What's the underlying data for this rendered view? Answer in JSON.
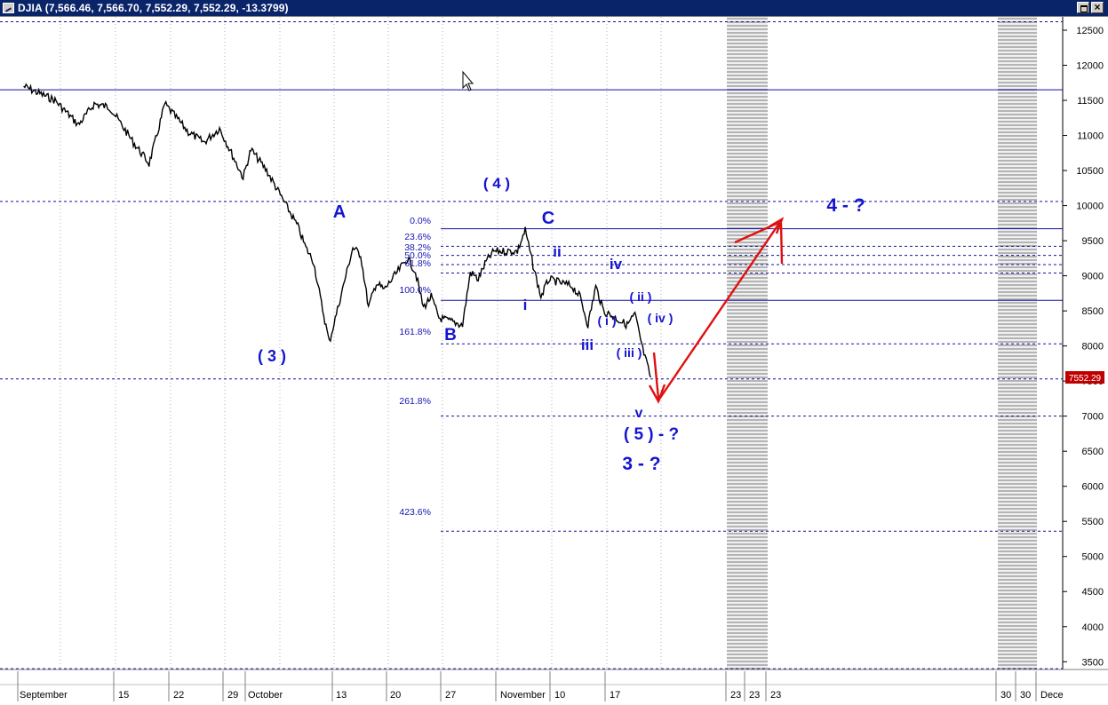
{
  "window": {
    "title": "DJIA (7,566.46, 7,566.70, 7,552.29, 7,552.29, -13.3799)"
  },
  "colors": {
    "titlebar": "#0a246a",
    "price": "#000000",
    "level_line": "#1010a0",
    "wave_label": "#1414d2",
    "projection_arrow": "#e01010",
    "last_price_badge": "#c00000"
  },
  "icons": [
    "app-icon",
    "restore-icon",
    "close-icon",
    "cursor-arrow-icon"
  ],
  "chart_data": {
    "type": "line",
    "title": "DJIA",
    "ylim": [
      3100,
      12650
    ],
    "y_ticks": [
      3500,
      4000,
      4500,
      5000,
      5500,
      6000,
      6500,
      7000,
      7500,
      8000,
      8500,
      9000,
      9500,
      10000,
      10500,
      11000,
      11500,
      12000,
      12500
    ],
    "x_labels": [
      "September",
      "15",
      "22",
      "29",
      "October",
      "13",
      "20",
      "27",
      "November",
      "10",
      "17",
      "23",
      "23",
      "23",
      "30",
      "30",
      "Dece"
    ],
    "grid": "vertical dotted",
    "last_price": "7552.29",
    "series": [
      {
        "values_approx": [
          [
            "2008-09-01",
            11700
          ],
          [
            "2008-09-05",
            11500
          ],
          [
            "2008-09-08",
            11150
          ],
          [
            "2008-09-10",
            11450
          ],
          [
            "2008-09-12",
            11400
          ],
          [
            "2008-09-15",
            10900
          ],
          [
            "2008-09-17",
            10600
          ],
          [
            "2008-09-18",
            11000
          ],
          [
            "2008-09-19",
            11450
          ],
          [
            "2008-09-22",
            11050
          ],
          [
            "2008-09-24",
            10900
          ],
          [
            "2008-09-26",
            11100
          ],
          [
            "2008-09-29",
            10400
          ],
          [
            "2008-09-30",
            10800
          ],
          [
            "2008-10-02",
            10500
          ],
          [
            "2008-10-03",
            10300
          ],
          [
            "2008-10-06",
            9700
          ],
          [
            "2008-10-07",
            9400
          ],
          [
            "2008-10-08",
            9200
          ],
          [
            "2008-10-09",
            8600
          ],
          [
            "2008-10-10",
            8050
          ],
          [
            "2008-10-13",
            9400
          ],
          [
            "2008-10-14",
            9300
          ],
          [
            "2008-10-15",
            8550
          ],
          [
            "2008-10-16",
            8900
          ],
          [
            "2008-10-17",
            8800
          ],
          [
            "2008-10-20",
            9250
          ],
          [
            "2008-10-21",
            9050
          ],
          [
            "2008-10-22",
            8550
          ],
          [
            "2008-10-23",
            8700
          ],
          [
            "2008-10-24",
            8400
          ],
          [
            "2008-10-27",
            8300
          ],
          [
            "2008-10-28",
            9050
          ],
          [
            "2008-10-29",
            8950
          ],
          [
            "2008-10-30",
            9200
          ],
          [
            "2008-10-31",
            9350
          ],
          [
            "2008-11-03",
            9350
          ],
          [
            "2008-11-04",
            9650
          ],
          [
            "2008-11-05",
            9150
          ],
          [
            "2008-11-06",
            8700
          ],
          [
            "2008-11-07",
            8950
          ],
          [
            "2008-11-10",
            8850
          ],
          [
            "2008-11-11",
            8700
          ],
          [
            "2008-11-12",
            8300
          ],
          [
            "2008-11-13",
            8850
          ],
          [
            "2008-11-14",
            8500
          ],
          [
            "2008-11-17",
            8300
          ],
          [
            "2008-11-18",
            8450
          ],
          [
            "2008-11-19",
            7950
          ],
          [
            "2008-11-20",
            7552
          ]
        ]
      }
    ],
    "horizontal_levels": [
      {
        "value": 12620,
        "style": "dashed"
      },
      {
        "value": 11650,
        "style": "solid"
      },
      {
        "value": 10060,
        "style": "dashed"
      },
      {
        "value": 9670,
        "style": "solid"
      },
      {
        "value": 9420,
        "style": "dashed"
      },
      {
        "value": 9290,
        "style": "dashed"
      },
      {
        "value": 9160,
        "style": "dashed"
      },
      {
        "value": 9040,
        "style": "dashed"
      },
      {
        "value": 8650,
        "style": "solid"
      },
      {
        "value": 8030,
        "style": "dashed"
      },
      {
        "value": 7530,
        "style": "dashed"
      },
      {
        "value": 7000,
        "style": "dashed"
      },
      {
        "value": 5360,
        "style": "dashed"
      },
      {
        "value": 3400,
        "style": "dashed"
      }
    ],
    "fib_labels": [
      "0.0%",
      "23.6%",
      "38.2%",
      "50.0%",
      "61.8%",
      "100.0%",
      "161.8%",
      "261.8%",
      "423.6%"
    ],
    "wave_labels": [
      "( 3 )",
      "A",
      "( 4 )",
      "B",
      "C",
      "i",
      "ii",
      "iii",
      "iv",
      "( i )",
      "( ii )",
      "( iii )",
      "( iv )",
      "v",
      "( 5 )  - ?",
      "3 - ?",
      "4 - ?"
    ],
    "projection": [
      [
        "2008-11-20",
        7552
      ],
      [
        "2008-11-21",
        6950
      ],
      [
        "2008-12-01",
        9680
      ]
    ]
  }
}
